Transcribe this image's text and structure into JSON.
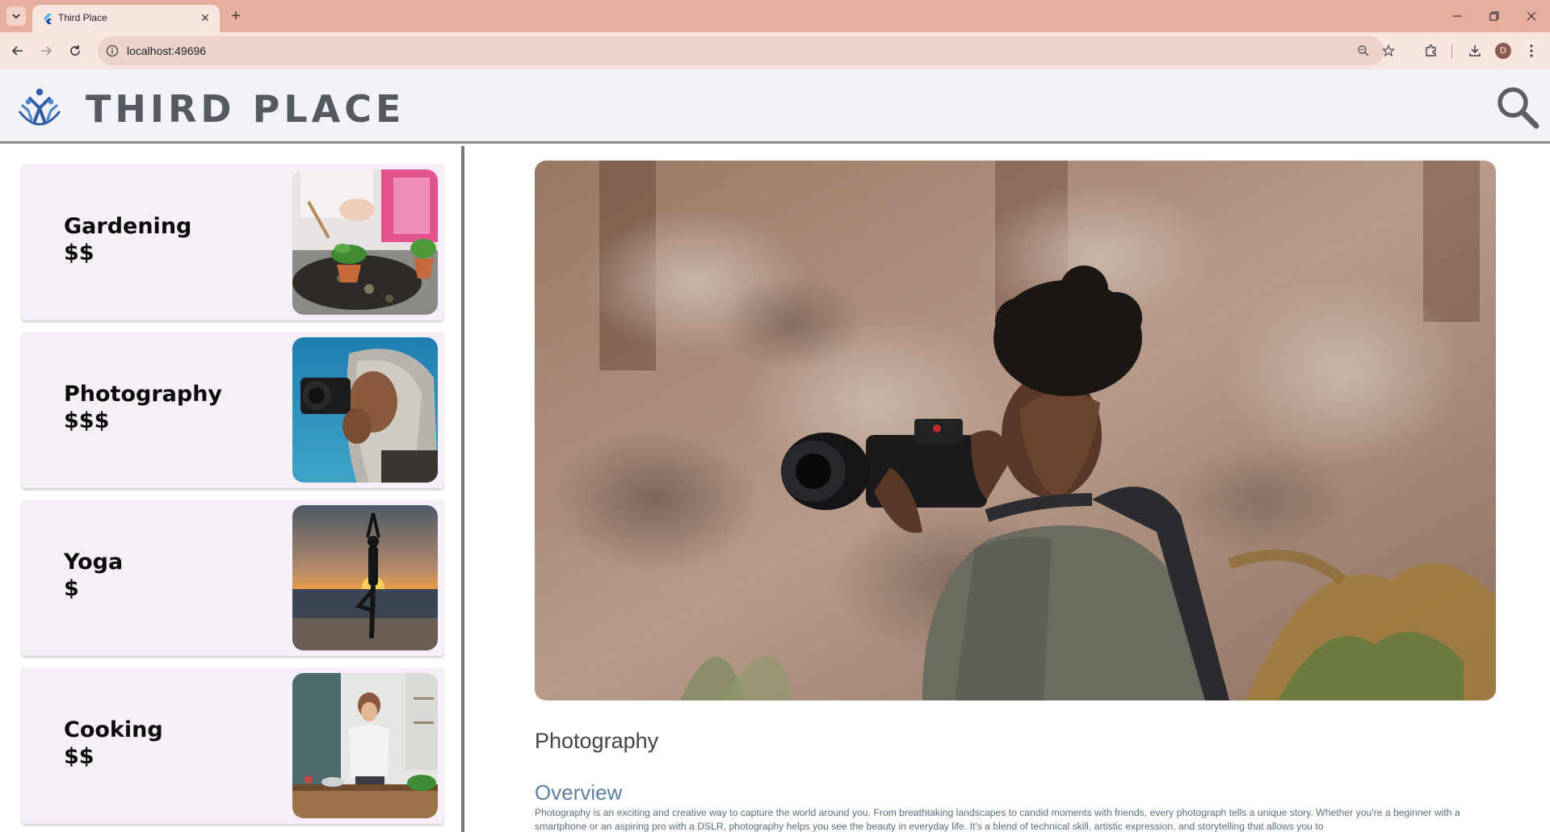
{
  "browser": {
    "tab_title": "Third Place",
    "url": "localhost:49696",
    "profile_initial": "D"
  },
  "app": {
    "brand": "THIRD PLACE"
  },
  "activities": [
    {
      "name": "Gardening",
      "price": "$$",
      "image": "gardening-photo"
    },
    {
      "name": "Photography",
      "price": "$$$",
      "image": "photography-photo"
    },
    {
      "name": "Yoga",
      "price": "$",
      "image": "yoga-photo"
    },
    {
      "name": "Cooking",
      "price": "$$",
      "image": "cooking-photo"
    }
  ],
  "detail": {
    "title": "Photography",
    "overview_heading": "Overview",
    "overview_text": "Photography is an exciting and creative way to capture the world around you. From breathtaking landscapes to candid moments with friends, every photograph tells a unique story. Whether you're a beginner with a smartphone or an aspiring pro with a DSLR, photography helps you see the beauty in everyday life. It's a blend of technical skill, artistic expression, and storytelling that allows you to"
  },
  "colors": {
    "tabbar": "#e7ad9e",
    "toolbar": "#f9e6e0",
    "header_bg": "#f3f2f7",
    "card_bg": "#f6eff8",
    "brand_text": "#555a60",
    "overview_heading": "#5b7f9e"
  }
}
